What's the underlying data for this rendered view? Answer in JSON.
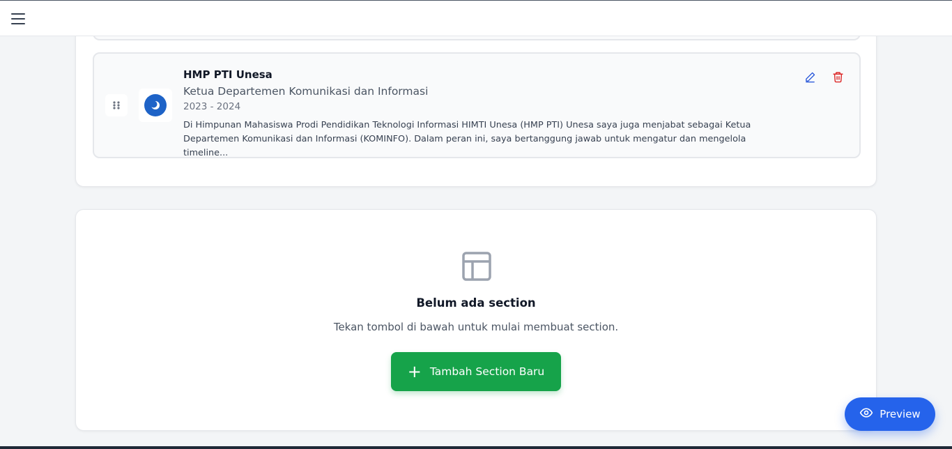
{
  "header": {
    "menu_icon": "hamburger-menu-icon"
  },
  "experience_item": {
    "organization": "HMP PTI Unesa",
    "role": "Ketua Departemen Komunikasi dan Informasi",
    "period": "2023 - 2024",
    "description_line1": "Di Himpunan Mahasiswa Prodi Pendidikan Teknologi Informasi HIMTI Unesa (HMP PTI) Unesa saya juga menjabat sebagai Ketua",
    "description_line2": "Departemen Komunikasi dan Informasi (KOMINFO). Dalam peran ini, saya bertanggung jawab untuk mengatur dan mengelola timeline...",
    "drag_icon": "drag-handle-icon",
    "edit_icon": "pencil-icon",
    "delete_icon": "trash-icon",
    "logo_icon": "organization-logo"
  },
  "empty_section": {
    "icon": "layout-icon",
    "title": "Belum ada section",
    "subtitle": "Tekan tombol di bawah untuk mulai membuat section.",
    "add_button_label": "Tambah Section Baru",
    "add_button_icon": "plus-icon"
  },
  "preview_button": {
    "label": "Preview",
    "icon": "eye-icon"
  },
  "colors": {
    "primary_blue": "#2563eb",
    "success_green": "#16a34a",
    "danger_red": "#dc2626",
    "edit_blue": "#1d4ed8",
    "page_background": "#f3f5f7"
  }
}
